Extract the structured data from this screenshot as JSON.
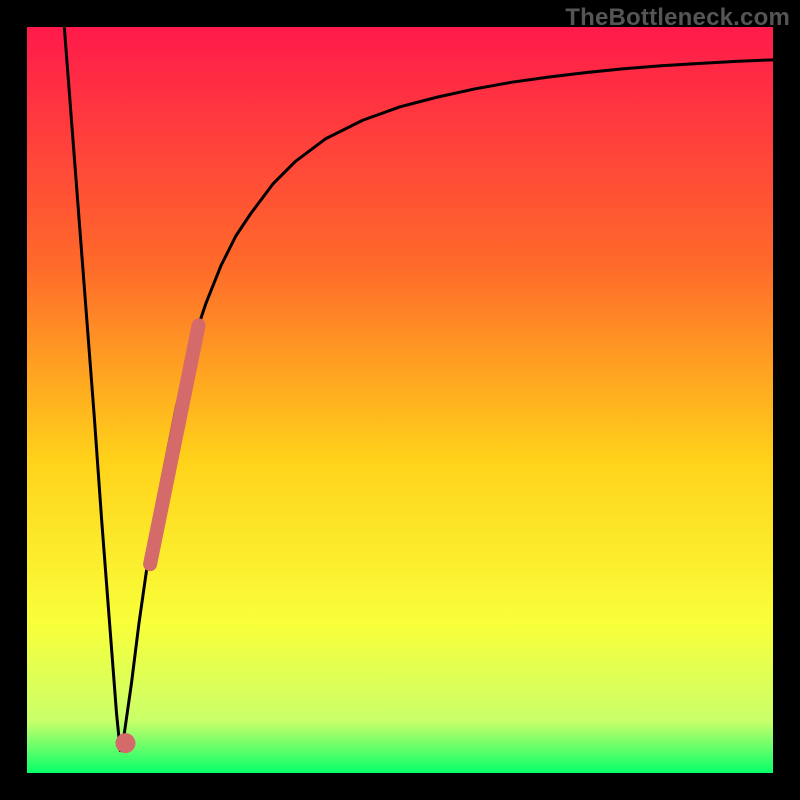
{
  "watermark": "TheBottleneck.com",
  "colors": {
    "grad_top": "#ff1a4b",
    "grad_mid_a": "#ff6a2a",
    "grad_mid_b": "#ffd21a",
    "grad_mid_c": "#f9ff3a",
    "grad_low": "#c9ff6a",
    "grad_bottom": "#07ff6a",
    "curve": "#000000",
    "line_segment": "#d46a6a",
    "dot": "#d46a6a",
    "frame": "#000000"
  },
  "chart_data": {
    "type": "line",
    "title": "",
    "xlabel": "",
    "ylabel": "",
    "xlim": [
      0,
      100
    ],
    "ylim": [
      0,
      100
    ],
    "series": [
      {
        "name": "bottleneck-curve",
        "x": [
          5,
          6,
          7,
          8,
          9,
          10,
          11,
          12,
          12.5,
          13,
          14,
          15,
          16,
          17,
          18,
          19,
          20,
          22,
          24,
          26,
          28,
          30,
          33,
          36,
          40,
          45,
          50,
          55,
          60,
          65,
          70,
          75,
          80,
          85,
          90,
          95,
          100
        ],
        "values": [
          100,
          87,
          74,
          61,
          48,
          34,
          21,
          8,
          3,
          5,
          12,
          20,
          27,
          33,
          39,
          44,
          49,
          57,
          63,
          68,
          72,
          75,
          79,
          82,
          85,
          87.5,
          89.3,
          90.6,
          91.7,
          92.6,
          93.3,
          93.9,
          94.4,
          94.8,
          95.1,
          95.4,
          95.6
        ]
      }
    ],
    "highlight_segment": {
      "name": "user-range",
      "x": [
        16.5,
        23
      ],
      "values": [
        28,
        60
      ]
    },
    "highlight_point": {
      "name": "optimal-point",
      "x": 13.2,
      "value": 4
    }
  }
}
